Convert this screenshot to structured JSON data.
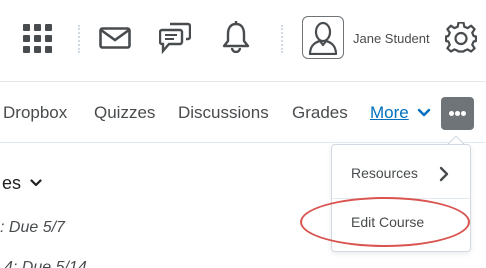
{
  "header": {
    "user_name": "Jane Student",
    "icons": [
      "apps-grid-icon",
      "mail-icon",
      "chat-icon",
      "bell-icon",
      "user-avatar-icon",
      "gear-icon"
    ]
  },
  "nav": {
    "items": [
      "Dropbox",
      "Quizzes",
      "Discussions",
      "Grades"
    ],
    "more_label": "More",
    "more_button_icon": "ellipsis-icon"
  },
  "content": {
    "heading": "es",
    "lines": [
      ": Due 5/7",
      "4: Due 5/14"
    ]
  },
  "dropdown": {
    "items": [
      {
        "label": "Resources",
        "has_submenu": true
      },
      {
        "label": "Edit Course",
        "has_submenu": false
      }
    ],
    "highlighted": "Edit Course",
    "highlight_color": "#d9534f"
  },
  "colors": {
    "link": "#006fbf",
    "text": "#494c4e",
    "button": "#6e7477"
  }
}
